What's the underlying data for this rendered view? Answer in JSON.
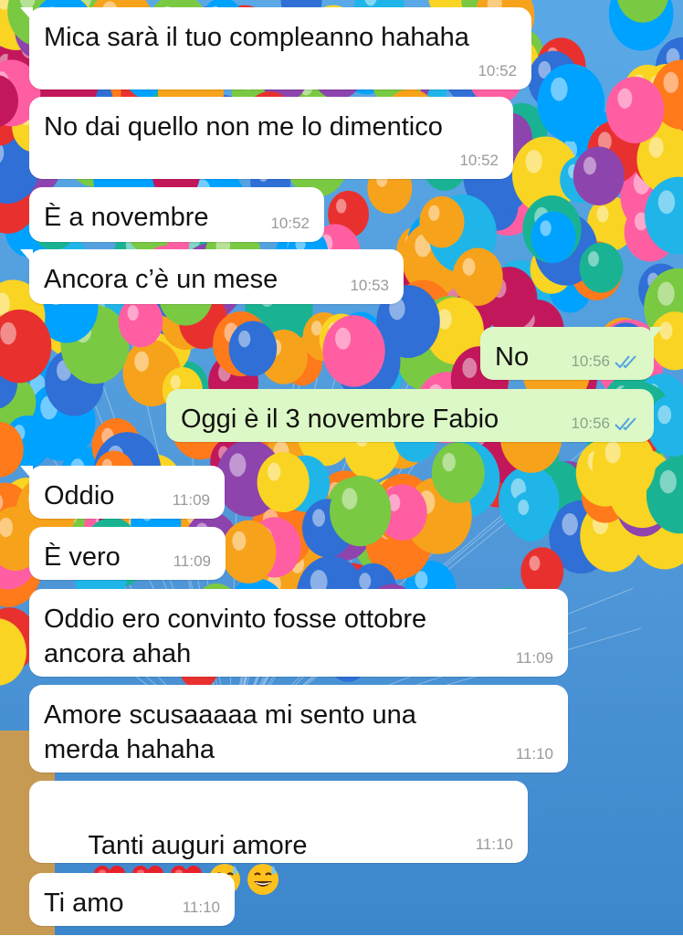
{
  "messages": [
    {
      "id": "m1",
      "dir": "in",
      "text": "Mica sarà il tuo compleanno hahaha",
      "time": "10:52"
    },
    {
      "id": "m2",
      "dir": "in",
      "text": "No dai quello non me lo dimentico",
      "time": "10:52"
    },
    {
      "id": "m3",
      "dir": "in",
      "text": "È a novembre",
      "time": "10:52"
    },
    {
      "id": "m4",
      "dir": "in",
      "text": "Ancora c’è un mese",
      "time": "10:53"
    },
    {
      "id": "m5",
      "dir": "out",
      "text": "No",
      "time": "10:56",
      "status": "read"
    },
    {
      "id": "m6",
      "dir": "out",
      "text": "Oggi è il 3 novembre Fabio",
      "time": "10:56",
      "status": "read"
    },
    {
      "id": "m7",
      "dir": "in",
      "text": "Oddio",
      "time": "11:09"
    },
    {
      "id": "m8",
      "dir": "in",
      "text": "È vero",
      "time": "11:09"
    },
    {
      "id": "m9",
      "dir": "in",
      "text": "Oddio ero convinto fosse ottobre\nancora ahah",
      "time": "11:09"
    },
    {
      "id": "m10",
      "dir": "in",
      "text": "Amore scusaaaaa mi sento una\nmerda hahaha",
      "time": "11:10"
    },
    {
      "id": "m11",
      "dir": "in",
      "text": "Tanti auguri amore",
      "emojis": [
        "heart",
        "heart",
        "heart",
        "grinning-sweat-face",
        "grinning-sweat-face"
      ],
      "time": "11:10"
    },
    {
      "id": "m12",
      "dir": "in",
      "text": "Ti amo",
      "time": "11:10"
    }
  ],
  "colors": {
    "incoming_bubble": "#ffffff",
    "outgoing_bubble": "#dcf8c6",
    "read_ticks": "#4fa3e0",
    "timestamp": "#9a9a9a"
  },
  "wallpaper": {
    "description_icon": "balloons-wallpaper"
  }
}
